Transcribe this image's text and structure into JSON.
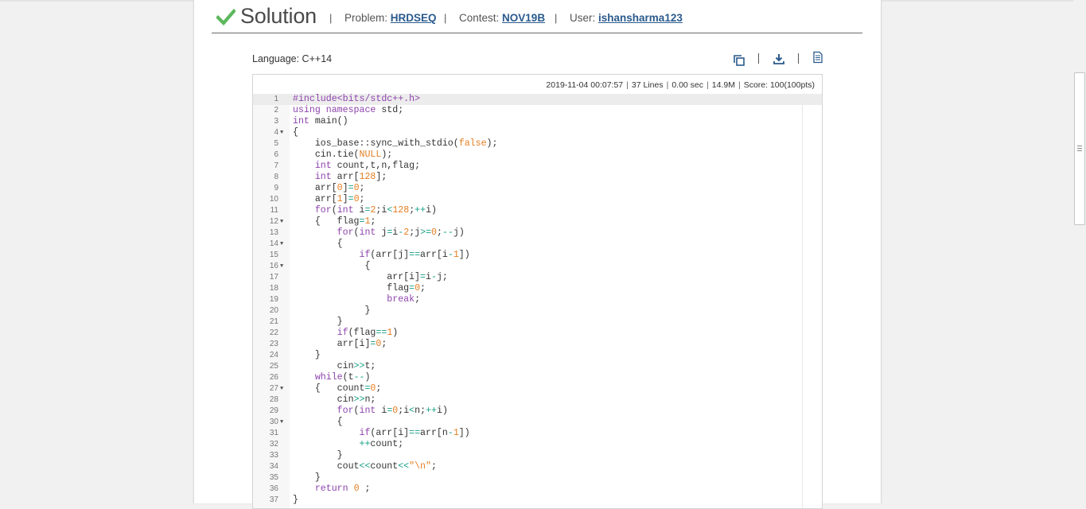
{
  "header": {
    "title": "Solution",
    "problem_label": "Problem:",
    "problem_value": "HRDSEQ",
    "contest_label": "Contest:",
    "contest_value": "NOV19B",
    "user_label": "User:",
    "user_value": "ishansharma123"
  },
  "language": "Language: C++14",
  "stats": {
    "timestamp": "2019-11-04 00:07:57",
    "lines": "37 Lines",
    "time": "0.00 sec",
    "memory": "14.9M",
    "score": "Score: 100(100pts)"
  },
  "colors": {
    "check": "#5cb85c",
    "link": "#2a5a8c",
    "keyword": "#8e44ad",
    "number": "#e67e22",
    "operator": "#16a085"
  },
  "icons": [
    "check-icon",
    "copy-icon",
    "download-icon",
    "document-icon"
  ],
  "code": [
    {
      "n": "1",
      "fold": false,
      "t": "#include<bits/stdc++.h>"
    },
    {
      "n": "2",
      "fold": false,
      "t": "using namespace std;"
    },
    {
      "n": "3",
      "fold": false,
      "t": "int main()"
    },
    {
      "n": "4",
      "fold": true,
      "t": "{"
    },
    {
      "n": "5",
      "fold": false,
      "t": "    ios_base::sync_with_stdio(false);"
    },
    {
      "n": "6",
      "fold": false,
      "t": "    cin.tie(NULL);"
    },
    {
      "n": "7",
      "fold": false,
      "t": "    int count,t,n,flag;"
    },
    {
      "n": "8",
      "fold": false,
      "t": "    int arr[128];"
    },
    {
      "n": "9",
      "fold": false,
      "t": "    arr[0]=0;"
    },
    {
      "n": "10",
      "fold": false,
      "t": "    arr[1]=0;"
    },
    {
      "n": "11",
      "fold": false,
      "t": "    for(int i=2;i<128;++i)"
    },
    {
      "n": "12",
      "fold": true,
      "t": "    {   flag=1;"
    },
    {
      "n": "13",
      "fold": false,
      "t": "        for(int j=i-2;j>=0;--j)"
    },
    {
      "n": "14",
      "fold": true,
      "t": "        {"
    },
    {
      "n": "15",
      "fold": false,
      "t": "            if(arr[j]==arr[i-1])"
    },
    {
      "n": "16",
      "fold": true,
      "t": "             {"
    },
    {
      "n": "17",
      "fold": false,
      "t": "                 arr[i]=i-j;"
    },
    {
      "n": "18",
      "fold": false,
      "t": "                 flag=0;"
    },
    {
      "n": "19",
      "fold": false,
      "t": "                 break;"
    },
    {
      "n": "20",
      "fold": false,
      "t": "             }"
    },
    {
      "n": "21",
      "fold": false,
      "t": "        }"
    },
    {
      "n": "22",
      "fold": false,
      "t": "        if(flag==1)"
    },
    {
      "n": "23",
      "fold": false,
      "t": "        arr[i]=0;"
    },
    {
      "n": "24",
      "fold": false,
      "t": "    }"
    },
    {
      "n": "25",
      "fold": false,
      "t": "        cin>>t;"
    },
    {
      "n": "26",
      "fold": false,
      "t": "    while(t--)"
    },
    {
      "n": "27",
      "fold": true,
      "t": "    {   count=0;"
    },
    {
      "n": "28",
      "fold": false,
      "t": "        cin>>n;"
    },
    {
      "n": "29",
      "fold": false,
      "t": "        for(int i=0;i<n;++i)"
    },
    {
      "n": "30",
      "fold": true,
      "t": "        {"
    },
    {
      "n": "31",
      "fold": false,
      "t": "            if(arr[i]==arr[n-1])"
    },
    {
      "n": "32",
      "fold": false,
      "t": "            ++count;"
    },
    {
      "n": "33",
      "fold": false,
      "t": "        }"
    },
    {
      "n": "34",
      "fold": false,
      "t": "        cout<<count<<\"\\n\";"
    },
    {
      "n": "35",
      "fold": false,
      "t": "    }"
    },
    {
      "n": "36",
      "fold": false,
      "t": "    return 0 ;"
    },
    {
      "n": "37",
      "fold": false,
      "t": "}"
    }
  ]
}
